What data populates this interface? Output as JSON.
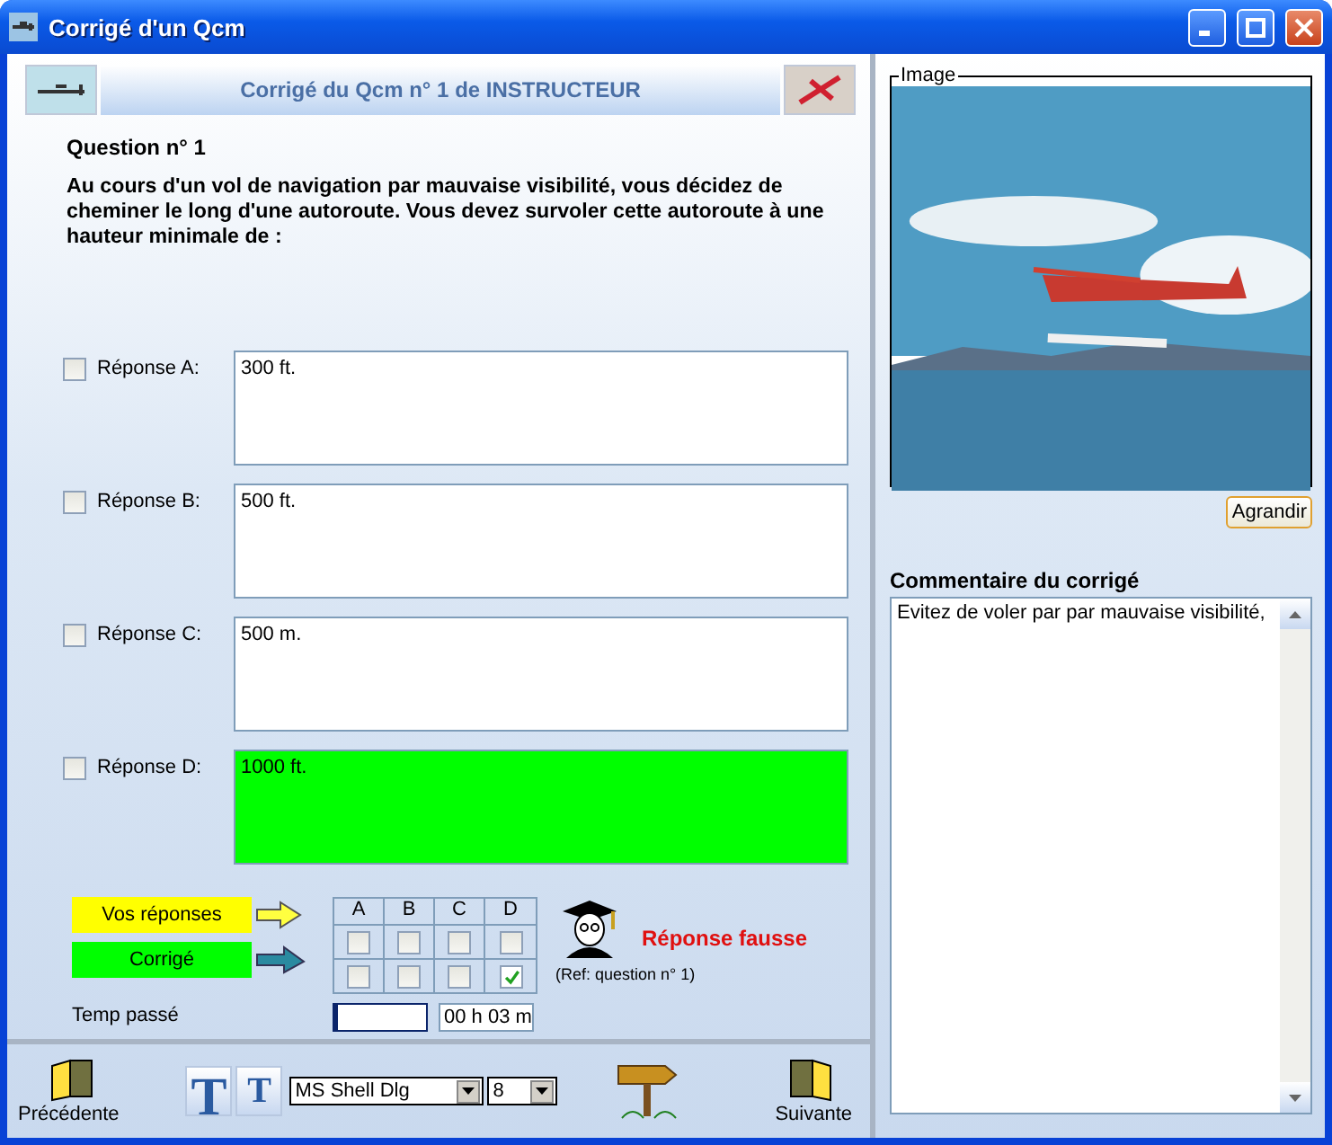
{
  "window": {
    "title": "Corrigé d'un Qcm"
  },
  "header": {
    "banner": "Corrigé du Qcm n° 1 de INSTRUCTEUR"
  },
  "question": {
    "label": "Question n° 1",
    "text": "Au cours d'un vol de navigation par mauvaise visibilité, vous décidez de cheminer le long d'une autoroute. Vous devez survoler cette autoroute à une hauteur minimale de :"
  },
  "answers": [
    {
      "label": "Réponse A:",
      "text": "300 ft.",
      "checked": false,
      "correct": false
    },
    {
      "label": "Réponse B:",
      "text": "500 ft.",
      "checked": false,
      "correct": false
    },
    {
      "label": "Réponse C:",
      "text": "500 m.",
      "checked": false,
      "correct": false
    },
    {
      "label": "Réponse D:",
      "text": "1000 ft.",
      "checked": false,
      "correct": true
    }
  ],
  "summary": {
    "your_answers_label": "Vos réponses",
    "correction_label": "Corrigé",
    "columns": [
      "A",
      "B",
      "C",
      "D"
    ],
    "your_answers": [
      {
        "checked": false
      },
      {
        "checked": false
      },
      {
        "checked": false
      },
      {
        "checked": false
      }
    ],
    "correction": [
      {
        "checked": false
      },
      {
        "checked": false
      },
      {
        "checked": false
      },
      {
        "checked": true
      }
    ],
    "result": "Réponse fausse",
    "reference": "(Ref: question n° 1)",
    "time_label": "Temp passé",
    "time_progress": {
      "level": 0.03
    },
    "time": "00 h 03 m"
  },
  "toolbar": {
    "previous": "Précédente",
    "larger_font": "T",
    "smaller_font": "T",
    "font": "MS Shell Dlg",
    "font_size": "8",
    "next": "Suivante"
  },
  "image_panel": {
    "legend": "Image",
    "button": "Agrandir"
  },
  "comment": {
    "label": "Commentaire du corrigé",
    "text": "Evitez de voler par par mauvaise visibilité,"
  }
}
